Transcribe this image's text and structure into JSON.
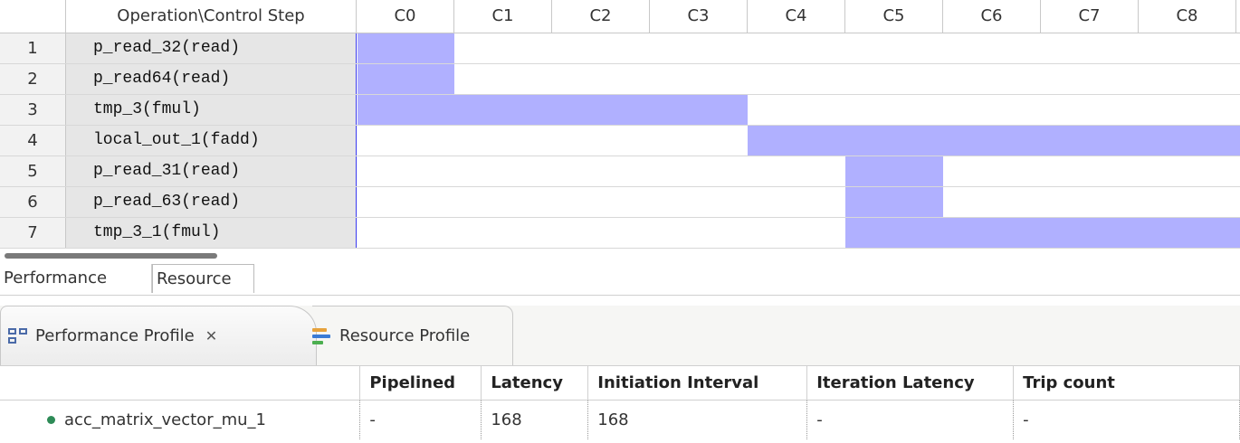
{
  "schedule": {
    "header": {
      "op": "Operation\\Control Step",
      "steps": [
        "C0",
        "C1",
        "C2",
        "C3",
        "C4",
        "C5",
        "C6",
        "C7",
        "C8"
      ]
    },
    "rows": [
      {
        "idx": "1",
        "op": "p_read_32(read)"
      },
      {
        "idx": "2",
        "op": "p_read64(read)"
      },
      {
        "idx": "3",
        "op": "tmp_3(fmul)"
      },
      {
        "idx": "4",
        "op": "local_out_1(fadd)"
      },
      {
        "idx": "5",
        "op": "p_read_31(read)"
      },
      {
        "idx": "6",
        "op": "p_read_63(read)"
      },
      {
        "idx": "7",
        "op": "tmp_3_1(fmul)"
      }
    ],
    "bar_color": "#b0b0ff"
  },
  "subtabs": {
    "performance": "Performance",
    "resource": "Resource"
  },
  "views": {
    "performance_profile": "Performance Profile",
    "close": "ꕕ",
    "resource_profile": "Resource Profile"
  },
  "profile": {
    "columns": [
      "",
      "Pipelined",
      "Latency",
      "Initiation Interval",
      "Iteration Latency",
      "Trip count"
    ],
    "rows": [
      {
        "name": "acc_matrix_vector_mu_1",
        "pipelined": "-",
        "latency": "168",
        "ii": "168",
        "iter_latency": "-",
        "trip": "-"
      }
    ]
  }
}
